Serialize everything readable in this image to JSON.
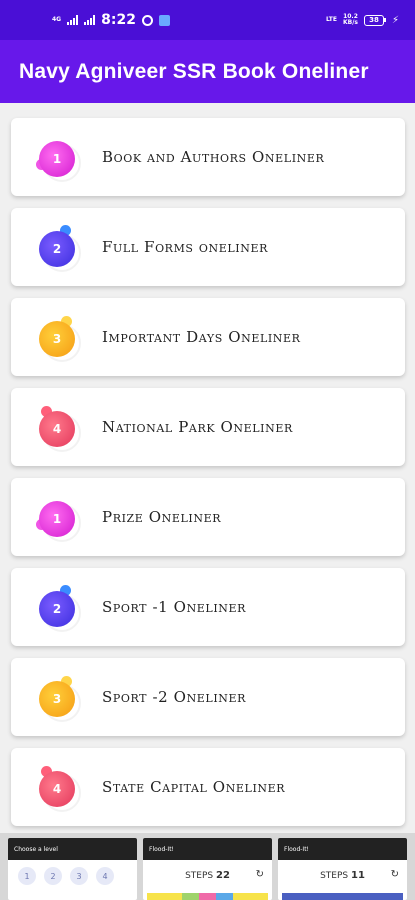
{
  "status_bar": {
    "network_left": "4G",
    "time": "8:22",
    "network_right": "LTE",
    "speed_value": "10.2",
    "speed_unit": "KB/s",
    "battery": "38"
  },
  "app_bar": {
    "title": "Navy Agniveer SSR Book Oneliner"
  },
  "items": [
    {
      "label": "Book and Authors Oneliner",
      "number": "1",
      "theme": "pink"
    },
    {
      "label": "Full Forms oneliner",
      "number": "2",
      "theme": "blue"
    },
    {
      "label": "Important Days Oneliner",
      "number": "3",
      "theme": "orange"
    },
    {
      "label": "National Park Oneliner",
      "number": "4",
      "theme": "red"
    },
    {
      "label": "Prize Oneliner",
      "number": "1",
      "theme": "pink"
    },
    {
      "label": "Sport -1 Oneliner",
      "number": "2",
      "theme": "blue"
    },
    {
      "label": "Sport -2 Oneliner",
      "number": "3",
      "theme": "orange"
    },
    {
      "label": "State Capital Oneliner",
      "number": "4",
      "theme": "red"
    }
  ],
  "ad": {
    "shot1_title": "Choose a level",
    "shot1_levels": [
      "1",
      "2",
      "3",
      "4"
    ],
    "shot2_title": "Flood-It!",
    "shot2_steps_label": "STEPS",
    "shot2_steps_value": "22",
    "shot3_title": "Flood-It!",
    "shot3_steps_label": "STEPS",
    "shot3_steps_value": "11"
  }
}
